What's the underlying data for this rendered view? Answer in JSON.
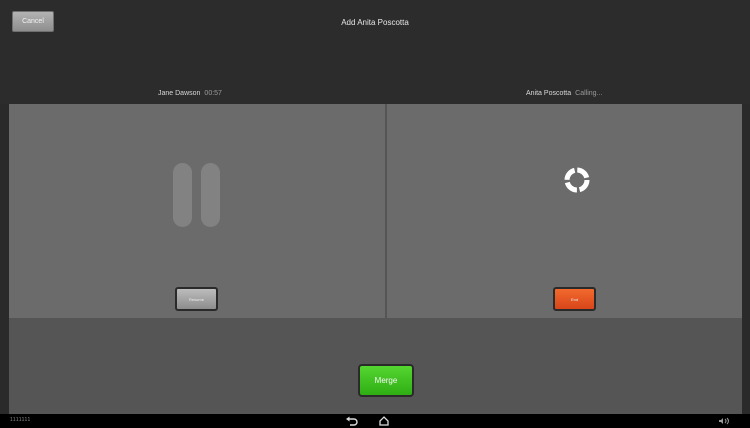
{
  "header": {
    "cancel_label": "Cancel",
    "title": "Add Anita Poscotta"
  },
  "callers": {
    "left": {
      "name": "Jane Dawson",
      "status": "00:57"
    },
    "right": {
      "name": "Anita Poscotta",
      "status": "Calling..."
    }
  },
  "buttons": {
    "resume_label": "Resume",
    "end_label": "End",
    "merge_label": "Merge"
  },
  "system_bar": {
    "left_text": "1111111",
    "back_icon": "back-icon",
    "home_icon": "home-icon",
    "volume_icon": "volume-icon"
  },
  "colors": {
    "merge": "#3ec41f",
    "end": "#e6541f",
    "panel": "#6b6b6b"
  }
}
